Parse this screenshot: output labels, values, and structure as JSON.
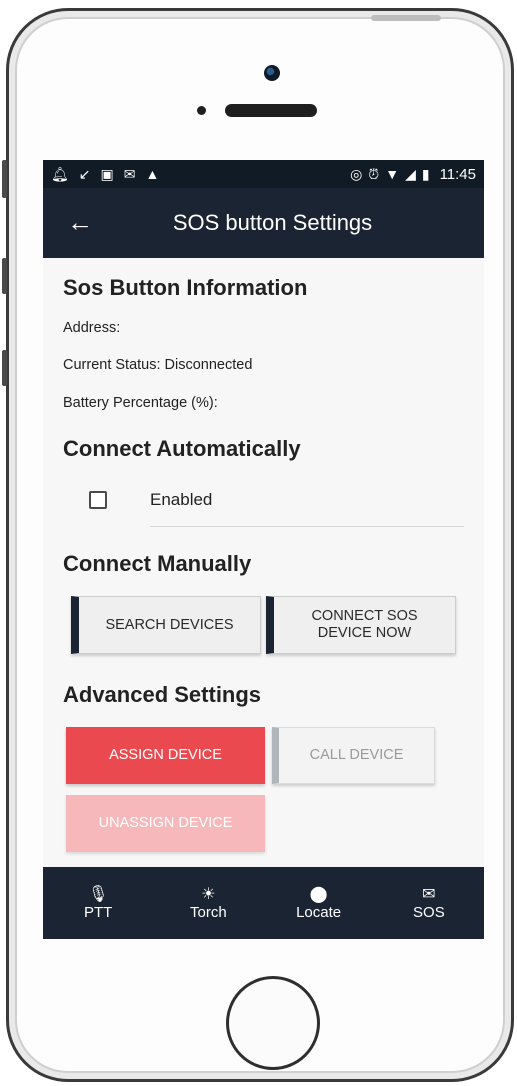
{
  "status_bar": {
    "left_icons": [
      "bell-icon",
      "missed-call-icon",
      "image-icon",
      "mail-icon",
      "warning-icon"
    ],
    "right_icons": [
      "data-saver-icon",
      "alarm-icon",
      "wifi-icon",
      "signal-icon",
      "battery-icon"
    ],
    "time": "11:45"
  },
  "toolbar": {
    "back_icon": "back-arrow-icon",
    "title": "SOS button Settings"
  },
  "info_section": {
    "heading": "Sos Button Information",
    "address_label": "Address:",
    "status_label": "Current Status: Disconnected",
    "battery_label": "Battery Percentage (%):"
  },
  "auto_section": {
    "heading": "Connect Automatically",
    "checkbox_label": "Enabled",
    "checked": false
  },
  "manual_section": {
    "heading": "Connect Manually",
    "search_button": "SEARCH DEVICES",
    "connect_button_line1": "CONNECT SOS",
    "connect_button_line2": "DEVICE NOW"
  },
  "advanced_section": {
    "heading": "Advanced Settings",
    "assign_button": "ASSIGN DEVICE",
    "call_button": "CALL DEVICE",
    "unassign_button": "UNASSIGN DEVICE"
  },
  "bottom_nav": {
    "items": [
      {
        "label": "PTT",
        "icon": "microphone-icon"
      },
      {
        "label": "Torch",
        "icon": "sun-icon"
      },
      {
        "label": "Locate",
        "icon": "location-pin-icon"
      },
      {
        "label": "SOS",
        "icon": "envelope-icon"
      }
    ]
  },
  "colors": {
    "toolbar": "#1a2433",
    "accent_red": "#ea4a4f",
    "accent_red_disabled": "#f6b8ba",
    "button_bar": "#1a2433"
  }
}
